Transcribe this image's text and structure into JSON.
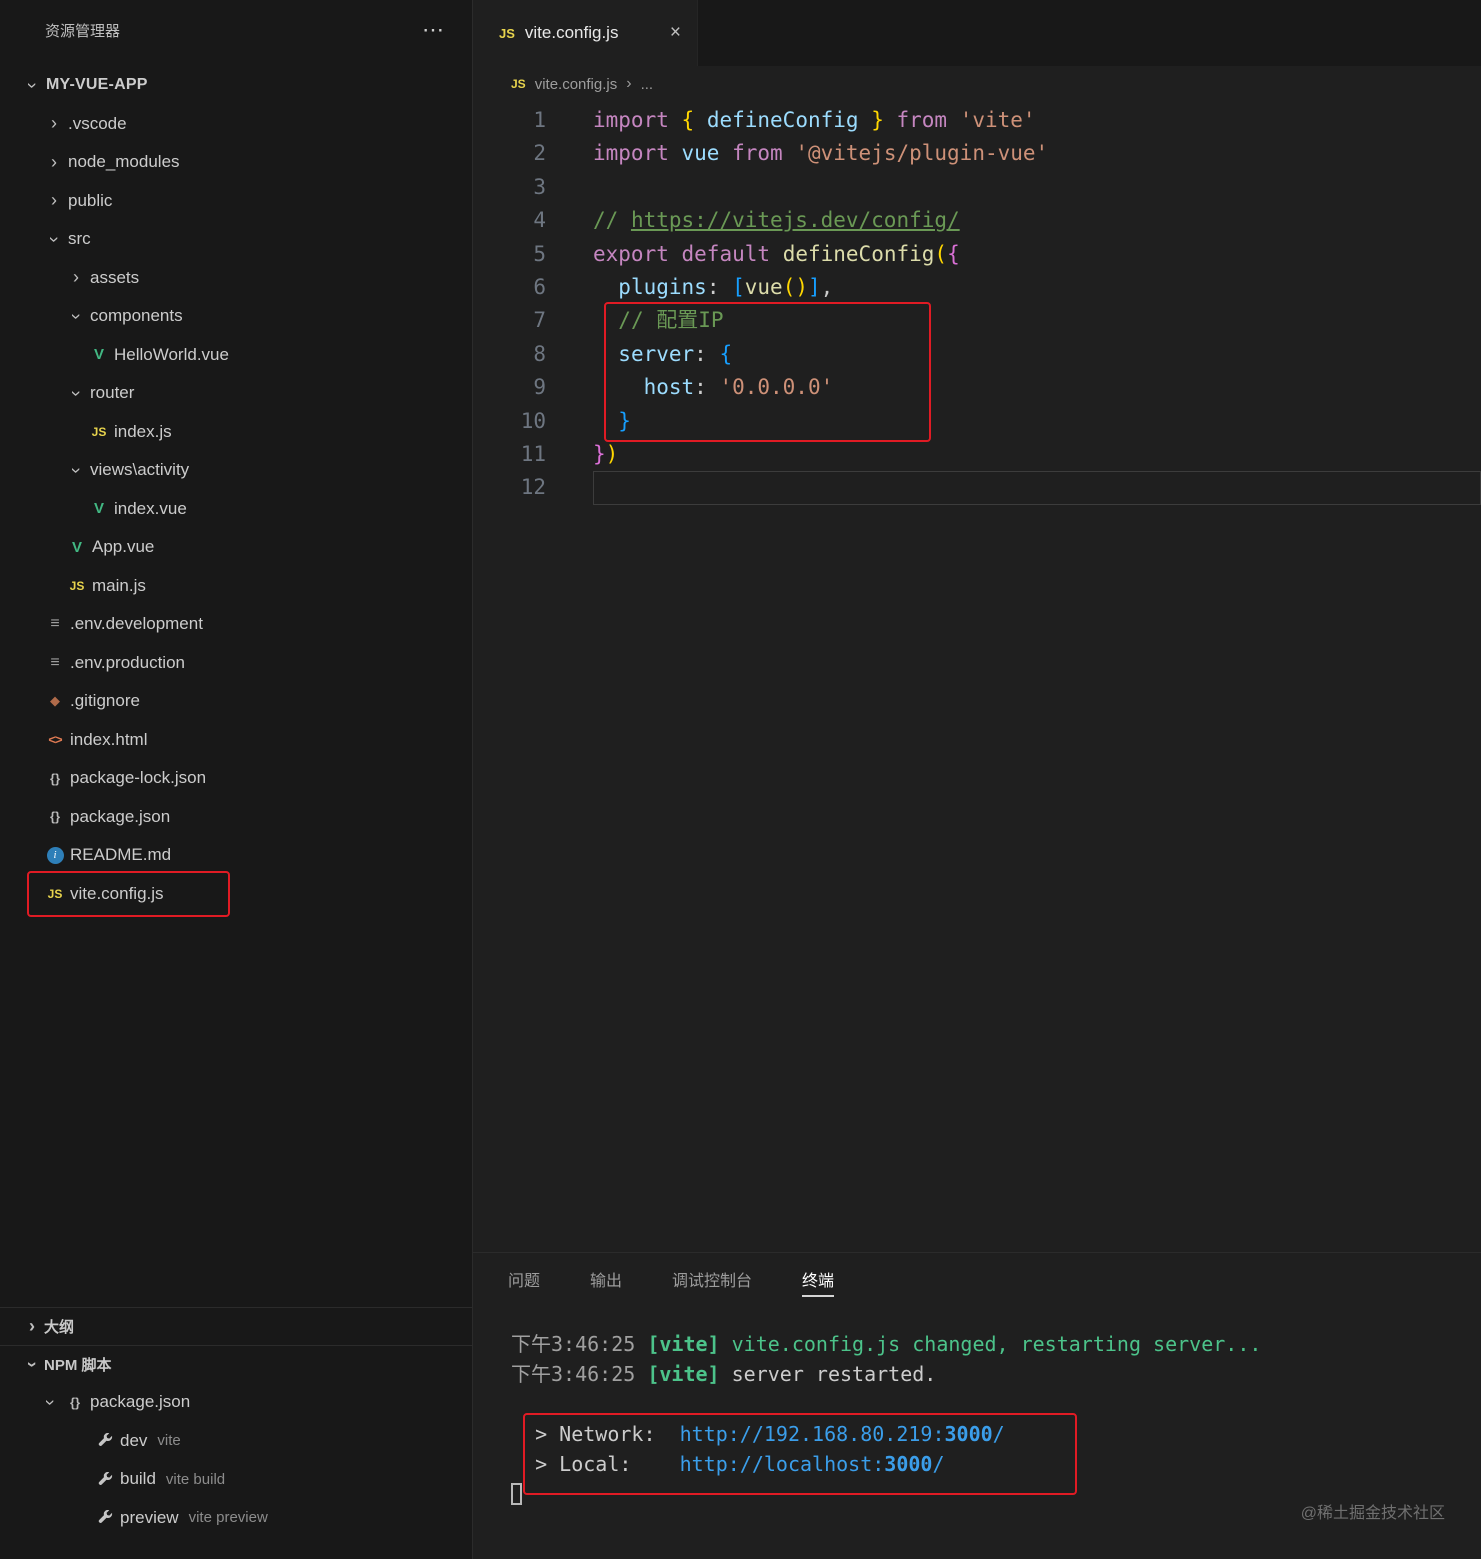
{
  "icons": {
    "chevron": "›",
    "more": "⋯",
    "close": "×",
    "vue": "V",
    "js": "JS",
    "env": "≡",
    "git": "◆",
    "html": "<>",
    "json": "{}",
    "info": "i",
    "crumb_sep": "›"
  },
  "colors": {
    "annotation_red": "#e01b24",
    "vue_green": "#42b883",
    "js_yellow": "#e8d44d",
    "terminal_link_blue": "#3b9eea",
    "vite_green": "#4cc38a"
  },
  "sidebar": {
    "title": "资源管理器",
    "tree": [
      {
        "label": "MY-VUE-APP",
        "lvl": 0,
        "kind": "root",
        "chev": "open"
      },
      {
        "label": ".vscode",
        "lvl": 1,
        "kind": "folder",
        "chev": "closed"
      },
      {
        "label": "node_modules",
        "lvl": 1,
        "kind": "folder",
        "chev": "closed"
      },
      {
        "label": "public",
        "lvl": 1,
        "kind": "folder",
        "chev": "closed"
      },
      {
        "label": "src",
        "lvl": 1,
        "kind": "folder",
        "chev": "open"
      },
      {
        "label": "assets",
        "lvl": 2,
        "kind": "folder",
        "chev": "closed"
      },
      {
        "label": "components",
        "lvl": 2,
        "kind": "folder",
        "chev": "open"
      },
      {
        "label": "HelloWorld.vue",
        "lvl": 3,
        "kind": "vue"
      },
      {
        "label": "router",
        "lvl": 2,
        "kind": "folder",
        "chev": "open"
      },
      {
        "label": "index.js",
        "lvl": 3,
        "kind": "js"
      },
      {
        "label": "views\\activity",
        "lvl": 2,
        "kind": "folder",
        "chev": "open"
      },
      {
        "label": "index.vue",
        "lvl": 3,
        "kind": "vue"
      },
      {
        "label": "App.vue",
        "lvl": 2,
        "kind": "vue"
      },
      {
        "label": "main.js",
        "lvl": 2,
        "kind": "js"
      },
      {
        "label": ".env.development",
        "lvl": 1,
        "kind": "env"
      },
      {
        "label": ".env.production",
        "lvl": 1,
        "kind": "env"
      },
      {
        "label": ".gitignore",
        "lvl": 1,
        "kind": "git"
      },
      {
        "label": "index.html",
        "lvl": 1,
        "kind": "html"
      },
      {
        "label": "package-lock.json",
        "lvl": 1,
        "kind": "json"
      },
      {
        "label": "package.json",
        "lvl": 1,
        "kind": "json"
      },
      {
        "label": "README.md",
        "lvl": 1,
        "kind": "info"
      },
      {
        "label": "vite.config.js",
        "lvl": 1,
        "kind": "js",
        "highlight": true
      }
    ],
    "outline": {
      "title": "大纲"
    },
    "npm": {
      "title": "NPM 脚本",
      "tree": [
        {
          "label": "package.json",
          "lvl": 0,
          "kind": "json",
          "chev": "open"
        },
        {
          "label": "dev",
          "desc": "vite",
          "lvl": 1,
          "kind": "wrench"
        },
        {
          "label": "build",
          "desc": "vite build",
          "lvl": 1,
          "kind": "wrench"
        },
        {
          "label": "preview",
          "desc": "vite preview",
          "lvl": 1,
          "kind": "wrench"
        }
      ]
    }
  },
  "editor": {
    "tab": {
      "label": "vite.config.js"
    },
    "breadcrumb": {
      "file": "vite.config.js",
      "more": "..."
    },
    "current_line": 12,
    "code": [
      {
        "n": 1,
        "toks": [
          [
            "kw",
            "import"
          ],
          [
            "pl",
            " "
          ],
          [
            "b1",
            "{"
          ],
          [
            "vr",
            " defineConfig "
          ],
          [
            "b1",
            "}"
          ],
          [
            "kw",
            " from "
          ],
          [
            "str",
            "'vite'"
          ]
        ]
      },
      {
        "n": 2,
        "toks": [
          [
            "kw",
            "import"
          ],
          [
            "vr",
            " vue "
          ],
          [
            "kw",
            "from"
          ],
          [
            "pl",
            " "
          ],
          [
            "str",
            "'@vitejs/plugin-vue'"
          ]
        ]
      },
      {
        "n": 3,
        "toks": []
      },
      {
        "n": 4,
        "toks": [
          [
            "cmt",
            "// "
          ],
          [
            "lnk",
            "https://vitejs.dev/config/"
          ]
        ]
      },
      {
        "n": 5,
        "toks": [
          [
            "kw",
            "export"
          ],
          [
            "pl",
            " "
          ],
          [
            "kw",
            "default"
          ],
          [
            "pl",
            " "
          ],
          [
            "fn",
            "defineConfig"
          ],
          [
            "b1",
            "("
          ],
          [
            "b2",
            "{"
          ]
        ]
      },
      {
        "n": 6,
        "toks": [
          [
            "pl",
            "  "
          ],
          [
            "vr",
            "plugins"
          ],
          [
            "pl",
            ": "
          ],
          [
            "b3",
            "["
          ],
          [
            "fn",
            "vue"
          ],
          [
            "b1",
            "()"
          ],
          [
            "b3",
            "]"
          ],
          [
            "pl",
            ","
          ]
        ]
      },
      {
        "n": 7,
        "toks": [
          [
            "pl",
            "  "
          ],
          [
            "cmt",
            "// 配置IP"
          ]
        ]
      },
      {
        "n": 8,
        "toks": [
          [
            "pl",
            "  "
          ],
          [
            "vr",
            "server"
          ],
          [
            "pl",
            ": "
          ],
          [
            "b3",
            "{"
          ]
        ]
      },
      {
        "n": 9,
        "toks": [
          [
            "pl",
            "    "
          ],
          [
            "vr",
            "host"
          ],
          [
            "pl",
            ": "
          ],
          [
            "str",
            "'0.0.0.0'"
          ]
        ]
      },
      {
        "n": 10,
        "toks": [
          [
            "pl",
            "  "
          ],
          [
            "b3",
            "}"
          ]
        ]
      },
      {
        "n": 11,
        "toks": [
          [
            "b2",
            "}"
          ],
          [
            "b1",
            ")"
          ]
        ]
      },
      {
        "n": 12,
        "toks": []
      }
    ]
  },
  "panel": {
    "tabs": [
      {
        "label": "问题",
        "active": false
      },
      {
        "label": "输出",
        "active": false
      },
      {
        "label": "调试控制台",
        "active": false
      },
      {
        "label": "终端",
        "active": true
      }
    ],
    "terminal": [
      {
        "toks": [
          [
            "dim",
            "下午3:46:25 "
          ],
          [
            "grnb",
            "[vite]"
          ],
          [
            "grn",
            " vite.config.js changed, restarting server..."
          ]
        ]
      },
      {
        "toks": [
          [
            "dim",
            "下午3:46:25 "
          ],
          [
            "grnb",
            "[vite]"
          ],
          [
            "pl",
            " server restarted."
          ]
        ]
      },
      {
        "toks": []
      },
      {
        "toks": [
          [
            "pl",
            "  > Network:  "
          ],
          [
            "cy",
            "http://192.168.80.219:"
          ],
          [
            "cyb",
            "3000"
          ],
          [
            "cy",
            "/"
          ]
        ]
      },
      {
        "toks": [
          [
            "pl",
            "  > Local:    "
          ],
          [
            "cy",
            "http://localhost:"
          ],
          [
            "cyb",
            "3000"
          ],
          [
            "cy",
            "/"
          ]
        ]
      },
      {
        "toks": [
          [
            "cursor",
            ""
          ]
        ]
      }
    ]
  },
  "watermark": "@稀土掘金技术社区"
}
